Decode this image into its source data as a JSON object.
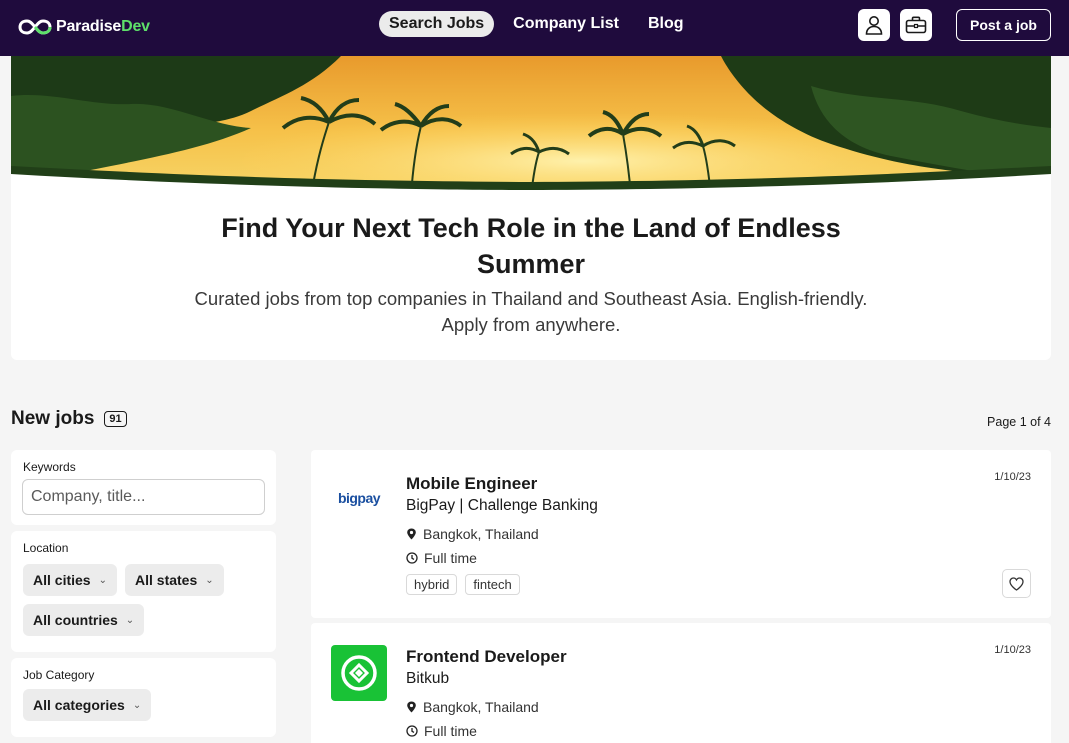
{
  "nav": {
    "logo": {
      "part1": "Paradise",
      "part2": "Dev"
    },
    "links": [
      {
        "label": "Search Jobs",
        "active": true
      },
      {
        "label": "Company List",
        "active": false
      },
      {
        "label": "Blog",
        "active": false
      }
    ],
    "icons": [
      "user-icon",
      "briefcase-icon"
    ],
    "post_job_label": "Post a job"
  },
  "hero": {
    "title": "Find Your Next Tech Role in the Land of Endless Summer",
    "subtitle": "Curated jobs from top companies in Thailand and Southeast Asia. English-friendly. Apply from anywhere."
  },
  "jobs_header": {
    "title": "New jobs",
    "count": "91",
    "page_indicator": "Page 1 of 4"
  },
  "filters": {
    "keywords": {
      "label": "Keywords",
      "placeholder": "Company, title..."
    },
    "location": {
      "label": "Location",
      "cities": "All cities",
      "states": "All states",
      "countries": "All countries"
    },
    "category": {
      "label": "Job Category",
      "value": "All categories"
    }
  },
  "jobs": [
    {
      "title": "Mobile Engineer",
      "company": "BigPay | Challenge Banking",
      "logo_text": "bigpay",
      "location": "Bangkok, Thailand",
      "type": "Full time",
      "date": "1/10/23",
      "tags": [
        "hybrid",
        "fintech"
      ]
    },
    {
      "title": "Frontend Developer",
      "company": "Bitkub",
      "logo_color": "#19c236",
      "location": "Bangkok, Thailand",
      "type": "Full time",
      "date": "1/10/23",
      "tags": []
    }
  ],
  "colors": {
    "nav_bg": "#1f0b3d",
    "accent_green": "#5ee06a",
    "bigpay_blue": "#1a4fa0",
    "bitkub_green": "#19c236"
  }
}
